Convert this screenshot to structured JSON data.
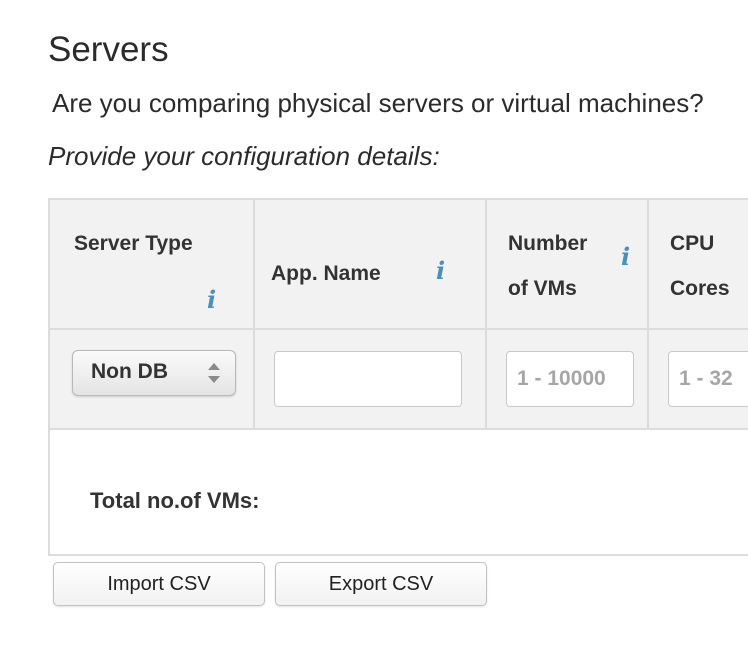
{
  "page": {
    "section_title": "Servers",
    "question": "Are you comparing physical servers or virtual machines?",
    "instruction": "Provide your configuration details:"
  },
  "table": {
    "columns": [
      {
        "label": "Server Type",
        "info_icon": "info-icon"
      },
      {
        "label": "App. Name",
        "info_icon": "info-icon"
      },
      {
        "label_line1": "Number",
        "label_line2": "of VMs",
        "info_icon": "info-icon"
      },
      {
        "label_line1": "CPU",
        "label_line2": "Cores"
      }
    ],
    "row": {
      "server_type_value": "Non DB",
      "app_name_value": "",
      "vms_placeholder": "1 - 10000",
      "cores_placeholder": "1 - 32"
    },
    "total_label": "Total no.of VMs:"
  },
  "actions": {
    "import_label": "Import CSV",
    "export_label": "Export CSV"
  },
  "colors": {
    "info_icon": "#4a90b8",
    "header_bg": "#f2f2f2",
    "border": "#dcdcdc"
  }
}
